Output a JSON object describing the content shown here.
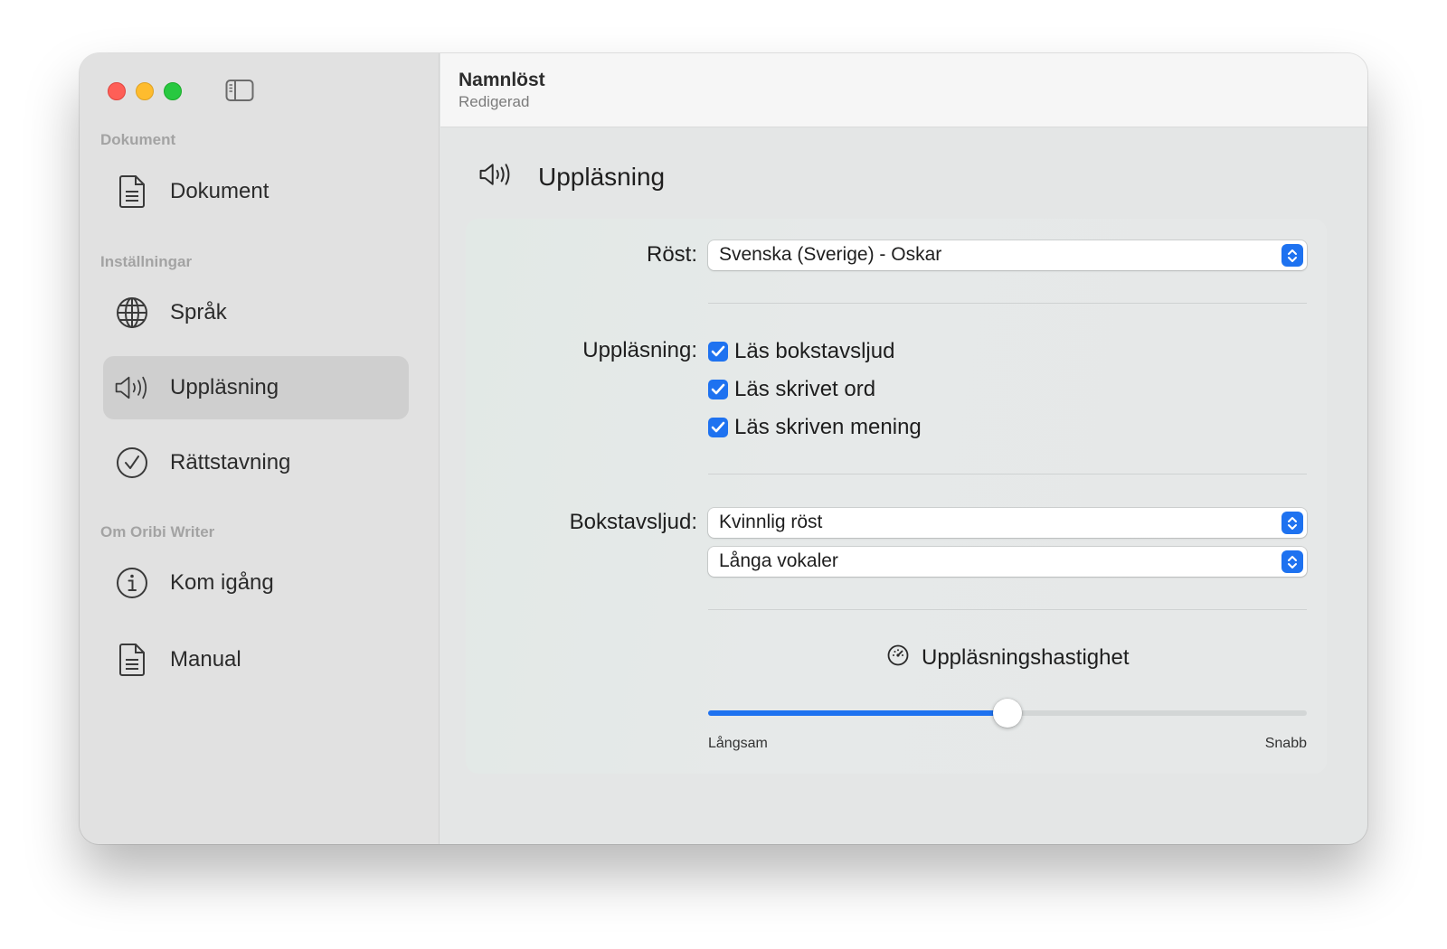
{
  "window": {
    "title": "Namnlöst",
    "subtitle": "Redigerad"
  },
  "sidebar": {
    "sections": [
      {
        "label": "Dokument"
      },
      {
        "label": "Inställningar"
      },
      {
        "label": "Om Oribi Writer"
      }
    ],
    "items": [
      {
        "label": "Dokument",
        "icon": "document-icon"
      },
      {
        "label": "Språk",
        "icon": "globe-icon"
      },
      {
        "label": "Uppläsning",
        "icon": "speaker-icon",
        "active": true
      },
      {
        "label": "Rättstavning",
        "icon": "checkmark-circle-icon"
      },
      {
        "label": "Kom igång",
        "icon": "info-icon"
      },
      {
        "label": "Manual",
        "icon": "document-icon"
      }
    ]
  },
  "main": {
    "heading": "Uppläsning",
    "voice": {
      "label": "Röst:",
      "value": "Svenska (Sverige) - Oskar"
    },
    "reading": {
      "label": "Uppläsning:",
      "options": [
        {
          "label": "Läs bokstavsljud",
          "checked": true
        },
        {
          "label": "Läs skrivet ord",
          "checked": true
        },
        {
          "label": "Läs skriven mening",
          "checked": true
        }
      ]
    },
    "letter_sounds": {
      "label": "Bokstavsljud:",
      "voice_value": "Kvinnlig röst",
      "vowel_value": "Långa vokaler"
    },
    "speed": {
      "heading": "Uppläsningshastighet",
      "min_label": "Långsam",
      "max_label": "Snabb",
      "value_fraction": 0.5
    }
  },
  "colors": {
    "accent": "#1e72f0",
    "close": "#fe5f57",
    "minimize": "#febc2e",
    "zoom": "#28c840"
  }
}
